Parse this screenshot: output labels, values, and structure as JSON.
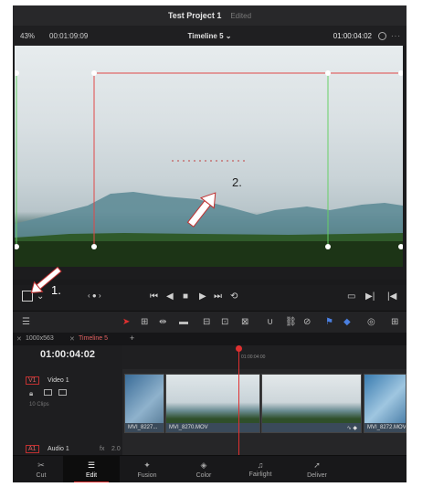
{
  "titlebar": {
    "project": "Test Project 1",
    "status": "Edited"
  },
  "viewer": {
    "zoom": "43%",
    "source_timecode": "00:01:09:09",
    "timeline_name": "Timeline 5",
    "record_timecode": "01:00:04:02"
  },
  "annotations": {
    "one": "1.",
    "two": "2."
  },
  "timeline": {
    "tabs": [
      "1000x563",
      "Timeline 5"
    ],
    "timecode": "01:00:04:02",
    "ruler_label": "01:00:04:00",
    "tracks": [
      {
        "id": "V1",
        "name": "Video 1",
        "clips_label": "10 Clips"
      },
      {
        "id": "A1",
        "name": "Audio 1",
        "level": "2.0"
      }
    ],
    "clips": [
      {
        "name": "MVI_8227..."
      },
      {
        "name": "MVI_8270.MOV"
      },
      {
        "name": ""
      },
      {
        "name": "MVI_8272.MOV"
      }
    ]
  },
  "pages": [
    {
      "label": "Cut",
      "icon": "cut-icon"
    },
    {
      "label": "Edit",
      "icon": "edit-icon"
    },
    {
      "label": "Fusion",
      "icon": "fusion-icon"
    },
    {
      "label": "Color",
      "icon": "color-icon"
    },
    {
      "label": "Fairlight",
      "icon": "fairlight-icon"
    },
    {
      "label": "Deliver",
      "icon": "deliver-icon"
    }
  ],
  "colors": {
    "accent": "#e03030",
    "crop_line": "#e04848",
    "guide_line": "#66d066"
  }
}
